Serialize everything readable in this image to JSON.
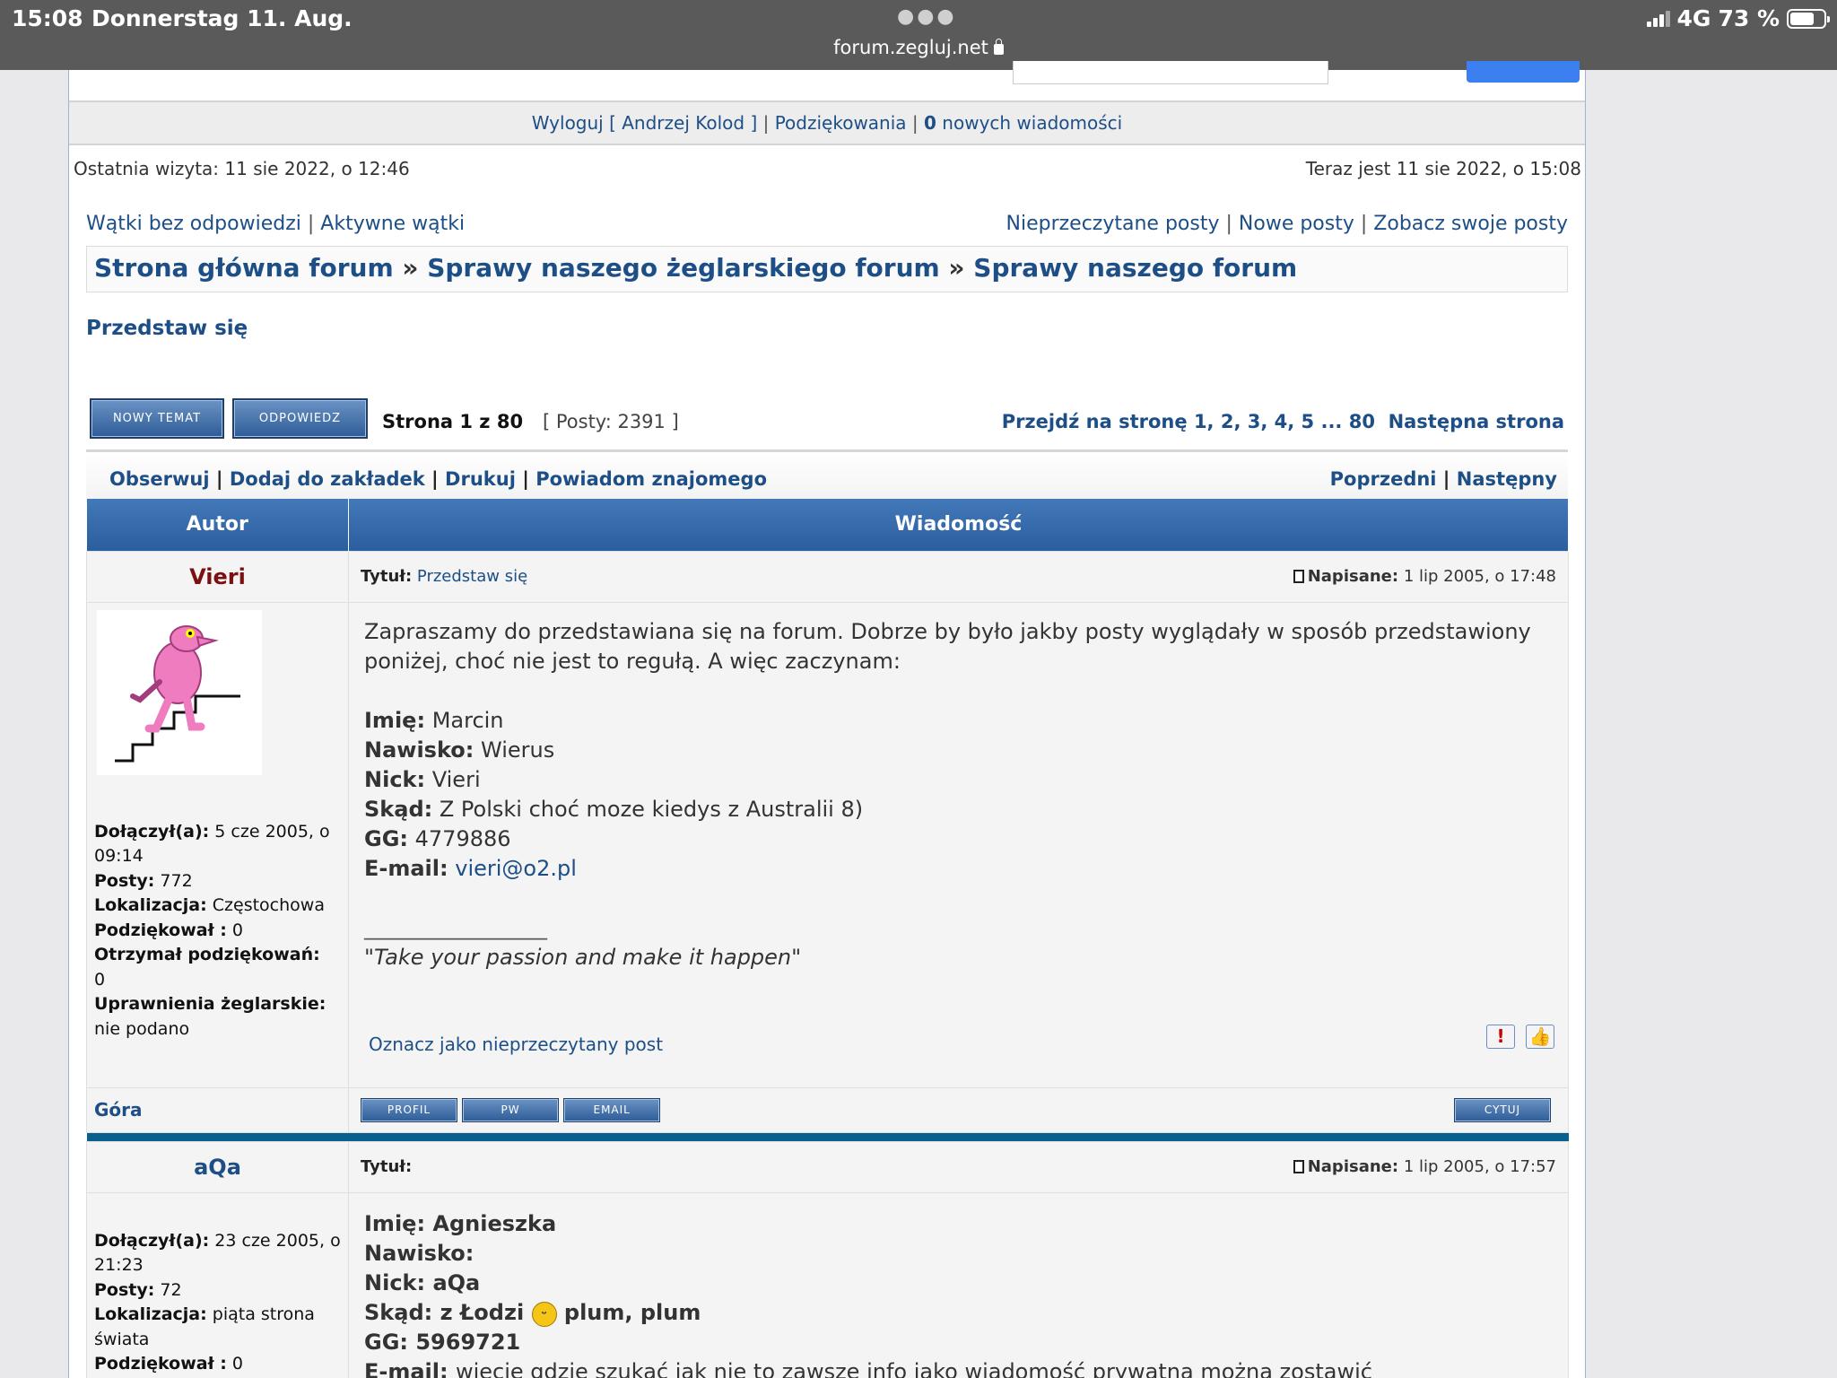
{
  "statusbar": {
    "time": "15:08",
    "date": "Donnerstag 11. Aug.",
    "url": "forum.zegluj.net",
    "network": "4G",
    "battery": "73 %",
    "battery_level": 0.73
  },
  "nav": {
    "logout": "Wyloguj [ Andrzej Kolod ]",
    "sep1": " | ",
    "thanks": "Podziękowania",
    "sep2": " | ",
    "new_count": "0",
    "new_messages": " nowych wiadomości"
  },
  "visit": {
    "last": "Ostatnia wizyta: 11 sie 2022, o 12:46",
    "now": "Teraz jest 11 sie 2022, o 15:08"
  },
  "links": {
    "unanswered": "Wątki bez odpowiedzi",
    "active": "Aktywne wątki",
    "unread": "Nieprzeczytane posty",
    "new": "Nowe posty",
    "own": "Zobacz swoje posty",
    "sep": " | "
  },
  "breadcrumb": {
    "home": "Strona główna forum",
    "sep": " » ",
    "cat": "Sprawy naszego żeglarskiego forum",
    "forum": "Sprawy naszego forum"
  },
  "topic": {
    "title": "Przedstaw się"
  },
  "buttons": {
    "new_topic": "NOWY TEMAT",
    "reply": "ODPOWIEDZ",
    "profile": "PROFIL",
    "pm": "PW",
    "email": "EMAIL",
    "quote": "CYTUJ"
  },
  "paging": {
    "page_label": "Strona 1 z 80",
    "posts_count": "[ Posty: 2391 ]",
    "goto": "Przejdź na stronę",
    "pages": "1, 2, 3, 4, 5 ... 80",
    "next": "Następna strona"
  },
  "actions": {
    "watch": "Obserwuj",
    "bookmark": "Dodaj do zakładek",
    "print": "Drukuj",
    "notify": "Powiadom znajomego",
    "prev": "Poprzedni",
    "nextt": "Następny",
    "sep": " | "
  },
  "table": {
    "col_author": "Autor",
    "col_message": "Wiadomość"
  },
  "post1": {
    "author": "Vieri",
    "author_color": "#7a1010",
    "title_label": "Tytuł:",
    "title": "Przedstaw się",
    "posted_label": "Napisane:",
    "posted": "1 lip 2005, o 17:48",
    "joined_label": "Dołączył(a):",
    "joined": "5 cze 2005, o 09:14",
    "posts_label": "Posty:",
    "posts": "772",
    "loc_label": "Lokalizacja:",
    "loc": "Częstochowa",
    "thanked_label": "Podziękował :",
    "thanked": "0",
    "received_label": "Otrzymał podziękowań:",
    "received": "0",
    "license_label": "Uprawnienia żeglarskie:",
    "license": "nie podano",
    "intro": "Zapraszamy do przedstawiana się na forum. Dobrze by było jakby posty wyglądały w sposób przedstawiony poniżej, choć nie jest to regułą. A więc zaczynam:",
    "f_name_l": "Imię:",
    "f_name": "Marcin",
    "f_nick2_l": "Nawisko:",
    "f_nick2": "Wierus",
    "f_nick_l": "Nick:",
    "f_nick": "Vieri",
    "f_from_l": "Skąd:",
    "f_from": "Z Polski choć moze kiedys z Australii 8)",
    "f_gg_l": "GG:",
    "f_gg": "4779886",
    "f_mail_l": "E-mail:",
    "f_mail": "vieri@o2.pl",
    "sig_line": "_________________",
    "signature": "\"Take your passion and make it happen\"",
    "mark_unread": "Oznacz jako nieprzeczytany post",
    "top": "Góra"
  },
  "post2": {
    "author": "aQa",
    "author_color": "#1d4f86",
    "title_label": "Tytuł:",
    "posted_label": "Napisane:",
    "posted": "1 lip 2005, o 17:57",
    "joined_label": "Dołączył(a):",
    "joined": "23 cze 2005, o 21:23",
    "posts_label": "Posty:",
    "posts": "72",
    "loc_label": "Lokalizacja:",
    "loc": "piąta strona świata",
    "thanked_label": "Podziękował :",
    "thanked": "0",
    "l1": "Imię: Agnieszka",
    "l2": "Nawisko:",
    "l3": "Nick: aQa",
    "l4a": "Skąd: z Łodzi",
    "l4b": "plum, plum",
    "l5": "GG: 5969721",
    "l6a": "E-mail:",
    "l6b": "wiecie gdzie szukać jak nie to zawsze info jako wiadomość prywatna można zostawić"
  }
}
